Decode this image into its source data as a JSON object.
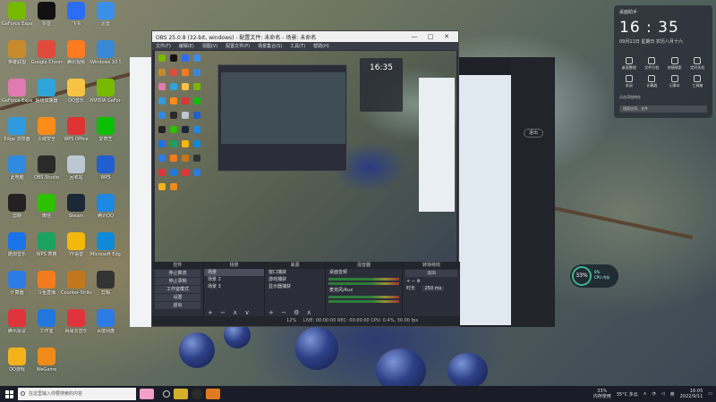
{
  "desktop_icons": [
    {
      "label": "GeForce Experience",
      "color": "#76b900"
    },
    {
      "label": "抖音",
      "color": "#111111"
    },
    {
      "label": "飞书",
      "color": "#2b6df5"
    },
    {
      "label": "迅雷",
      "color": "#3b8fe8"
    },
    {
      "label": "英雄联盟",
      "color": "#c78b2e"
    },
    {
      "label": "Google Chrome",
      "color": "#e04b3b"
    },
    {
      "label": "腾讯视频",
      "color": "#ff7a20"
    },
    {
      "label": "Windows 10 Skin",
      "color": "#3a89d6"
    },
    {
      "label": "GeForce Experience 2020",
      "color": "#e07ab0"
    },
    {
      "label": "超级加速器",
      "color": "#2fa4d8"
    },
    {
      "label": "QQ音乐",
      "color": "#f6c343"
    },
    {
      "label": "NVIDIA GeForce",
      "color": "#76b900"
    },
    {
      "label": "Edge 浏览器",
      "color": "#2f9ae0"
    },
    {
      "label": "火绒安全",
      "color": "#ff8c1a"
    },
    {
      "label": "WPS Office",
      "color": "#d33"
    },
    {
      "label": "爱奇艺",
      "color": "#0bbe06"
    },
    {
      "label": "此电脑",
      "color": "#2f8ae0"
    },
    {
      "label": "OBS Studio",
      "color": "#2a2a2a"
    },
    {
      "label": "回收站",
      "color": "#bcc7d2"
    },
    {
      "label": "WPS",
      "color": "#1f5fcf"
    },
    {
      "label": "剪映",
      "color": "#222"
    },
    {
      "label": "微信",
      "color": "#2dc100"
    },
    {
      "label": "Steam",
      "color": "#1b2838"
    },
    {
      "label": "腾讯QQ",
      "color": "#1e88e5"
    },
    {
      "label": "酷狗音乐",
      "color": "#1a73e8"
    },
    {
      "label": "WPS 表格",
      "color": "#1aa260"
    },
    {
      "label": "YY语音",
      "color": "#f2b90c"
    },
    {
      "label": "Microsoft Edge",
      "color": "#0f8ad8"
    },
    {
      "label": "计算器",
      "color": "#2d7be5"
    },
    {
      "label": "斗鱼直播",
      "color": "#f27b1d"
    },
    {
      "label": "Counter-Strike Global",
      "color": "#c2771c"
    },
    {
      "label": "剪辑",
      "color": "#333"
    },
    {
      "label": "腾讯会议",
      "color": "#e0343c"
    },
    {
      "label": "工作室",
      "color": "#2277dd"
    },
    {
      "label": "网易云音乐",
      "color": "#e0343c"
    },
    {
      "label": "百度网盘",
      "color": "#2d7be5"
    },
    {
      "label": "QQ游戏",
      "color": "#f3b21c"
    },
    {
      "label": "WeGame",
      "color": "#f08a1b"
    }
  ],
  "obs": {
    "title": "OBS 25.0.8 (32-bit, windows) - 配置文件: 未命名 - 场景: 未命名",
    "menu": [
      "文件(F)",
      "编辑(E)",
      "视图(V)",
      "配置文件(P)",
      "场景集合(S)",
      "工具(T)",
      "帮助(H)"
    ],
    "docks": {
      "scenes_header": "场景",
      "scenes": [
        "场景",
        "场景 2",
        "场景 3"
      ],
      "sources_header": "来源",
      "sources": [
        "窗口捕获",
        "游戏捕获",
        "显示器捕获"
      ],
      "mixer_header": "混音器",
      "mixer": [
        "桌面音频",
        "麦克风/Aux"
      ],
      "transitions_header": "转场特效",
      "transition_value": "淡出",
      "duration_label": "时长",
      "duration_value": "250 ms",
      "controls_header": "控件",
      "controls": [
        "停止推流",
        "停止录制",
        "工作室模式",
        "设置",
        "退出"
      ]
    },
    "status": "LIVE: 00:00:00   REC: 00:00:00   CPU: 0.4%, 30.00 fps",
    "fps_badge": "12%"
  },
  "preview": {
    "widget_time": "16:35"
  },
  "dark_window": {
    "button": "退出"
  },
  "widget": {
    "title": "桌面助手",
    "time": "16 : 35",
    "date": "09月11日   星期日   农历八月十六",
    "tools": [
      "桌面整理",
      "文件归档",
      "快捷搜索",
      "定时关机",
      "关闭",
      "计算器",
      "记事本",
      "工具箱"
    ],
    "note": "点击添加待办",
    "search": "搜索应用、文件"
  },
  "gauge": {
    "percent": "33%",
    "line1": "0%",
    "line2": "CPU 内存"
  },
  "taskbar": {
    "search_placeholder": "在这里输入你要搜索的内容",
    "memory": "33%",
    "memory_label": "内存使用",
    "weather": "35°C 多云",
    "ime": "英",
    "time": "16:05",
    "date": "2022/9/11"
  }
}
